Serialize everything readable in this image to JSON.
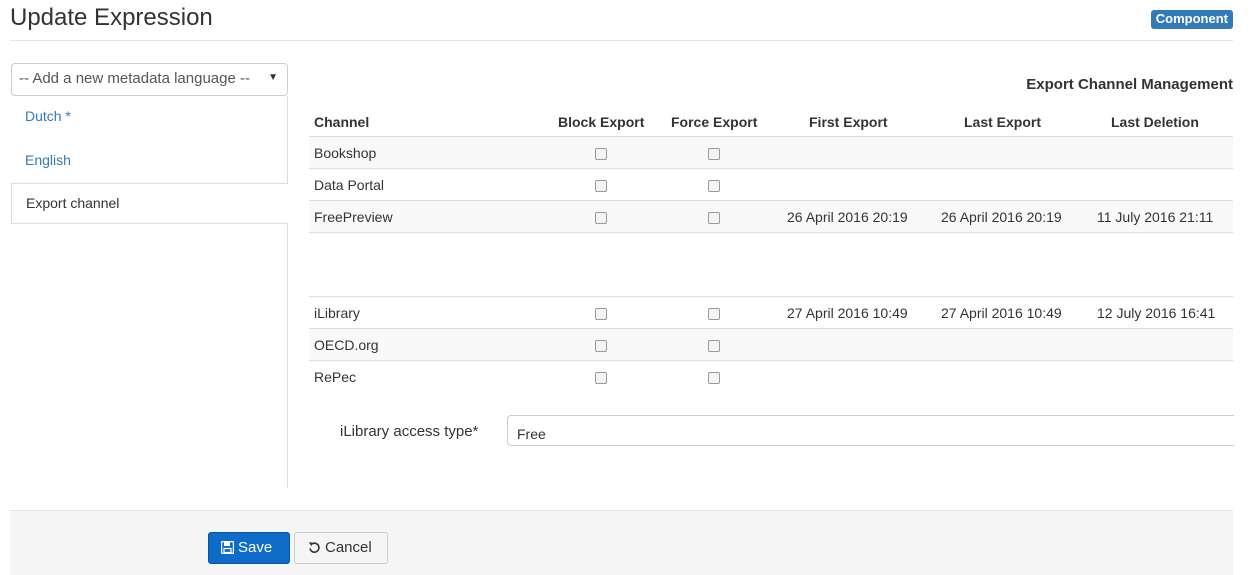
{
  "header": {
    "title": "Update Expression",
    "badge": "Component"
  },
  "sidebar": {
    "language_select": "-- Add a new metadata language --",
    "items": [
      {
        "label": "Dutch *"
      },
      {
        "label": "English"
      },
      {
        "label": "Export channel"
      }
    ]
  },
  "export": {
    "title": "Export Channel Management",
    "columns": [
      "Channel",
      "Block Export",
      "Force Export",
      "First Export",
      "Last Export",
      "Last Deletion"
    ],
    "rows": [
      {
        "channel": "Bookshop",
        "first": "",
        "last": "",
        "deletion": ""
      },
      {
        "channel": "Data Portal",
        "first": "",
        "last": "",
        "deletion": ""
      },
      {
        "channel": "FreePreview",
        "first": "26 April 2016 20:19",
        "last": "26 April 2016 20:19",
        "deletion": "11 July 2016 21:11"
      },
      {
        "channel": "iLibrary",
        "first": "27 April 2016 10:49",
        "last": "27 April 2016 10:49",
        "deletion": "12 July 2016 16:41"
      },
      {
        "channel": "OECD.org",
        "first": "",
        "last": "",
        "deletion": ""
      },
      {
        "channel": "RePec",
        "first": "",
        "last": "",
        "deletion": ""
      }
    ],
    "access_type_label": "iLibrary access type*",
    "access_type_value": "Free"
  },
  "footer": {
    "save_label": "Save",
    "cancel_label": "Cancel"
  },
  "colors": {
    "accent": "#337ab7",
    "primary_button": "#0f6bc8"
  }
}
